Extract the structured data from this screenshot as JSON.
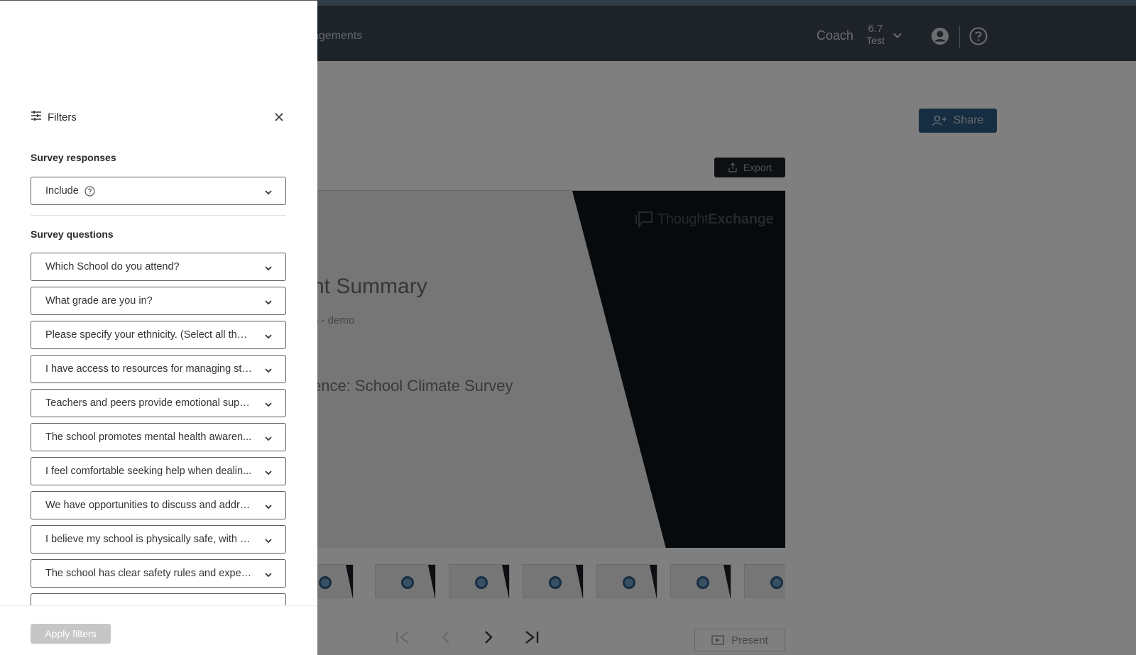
{
  "background": {
    "nav_item": "agements",
    "coach_label": "Coach",
    "version_number": "6.7",
    "version_label": "Test",
    "share_label": "Share",
    "export_label": "Export",
    "slide": {
      "brand_light": "Thought",
      "brand_bold": "Exchange",
      "title": "nt Summary",
      "subtitle": "o - demo",
      "survey_title": "ence: School Climate Survey"
    },
    "present_label": "Present"
  },
  "drawer": {
    "title": "Filters",
    "survey_responses": {
      "label": "Survey responses",
      "selected": "Include"
    },
    "survey_questions": {
      "label": "Survey questions",
      "items": [
        "Which School do you attend?",
        "What grade are you in?",
        "Please specify your ethnicity. (Select all that...",
        "I have access to resources for managing stre...",
        "Teachers and peers provide emotional supp...",
        "The school promotes mental health awaren...",
        "I feel comfortable seeking help when dealin...",
        "We have opportunities to discuss and addre...",
        "I believe my school is physically safe, with m...",
        "The school has clear safety rules and expect...",
        ""
      ]
    },
    "apply_label": "Apply filters"
  },
  "colors": {
    "topbar": "#3a4651",
    "topbar_accent": "#5e7c93",
    "share_button": "#2f5b84",
    "apply_disabled": "#c6c6c6",
    "select_border": "#5f5f5f"
  }
}
